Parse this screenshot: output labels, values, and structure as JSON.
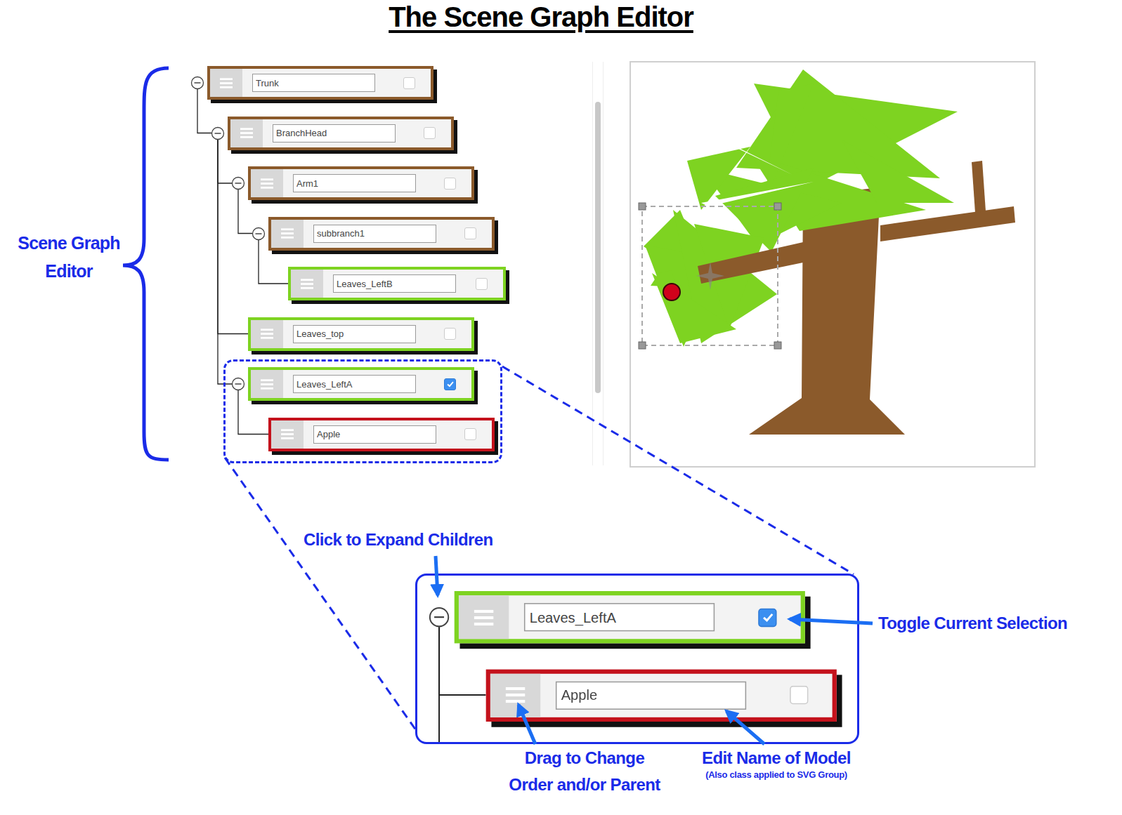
{
  "title": "The Scene Graph Editor",
  "editor_label": [
    "Scene Graph",
    "Editor"
  ],
  "tree": [
    {
      "name": "Trunk",
      "color": "#8b5a2b",
      "checked": false,
      "expanded": true,
      "children": [
        {
          "name": "BranchHead",
          "color": "#8b5a2b",
          "checked": false,
          "expanded": true,
          "children": [
            {
              "name": "Arm1",
              "color": "#8b5a2b",
              "checked": false,
              "expanded": true,
              "children": [
                {
                  "name": "subbranch1",
                  "color": "#8b5a2b",
                  "checked": false,
                  "expanded": true,
                  "children": [
                    {
                      "name": "Leaves_LeftB",
                      "color": "#7ed321",
                      "checked": false,
                      "expanded": false,
                      "children": []
                    }
                  ]
                }
              ]
            },
            {
              "name": "Leaves_top",
              "color": "#7ed321",
              "checked": false,
              "expanded": false,
              "children": []
            },
            {
              "name": "Leaves_LeftA",
              "color": "#7ed321",
              "checked": true,
              "expanded": true,
              "children": [
                {
                  "name": "Apple",
                  "color": "#c4121c",
                  "checked": false,
                  "expanded": false,
                  "children": []
                }
              ]
            }
          ]
        }
      ]
    }
  ],
  "zoom": [
    {
      "name": "Leaves_LeftA",
      "color": "#7ed321",
      "checked": true,
      "expanded": true,
      "children": [
        {
          "name": "Apple",
          "color": "#c4121c",
          "checked": false,
          "expanded": false,
          "children": []
        }
      ]
    }
  ],
  "annotations": {
    "expand": "Click to Expand Children",
    "select": "Toggle Current Selection",
    "drag": [
      "Drag to Change",
      "Order and/or Parent"
    ],
    "name": "Edit Name of Model",
    "name_note": "(Also class applied to SVG Group)"
  }
}
